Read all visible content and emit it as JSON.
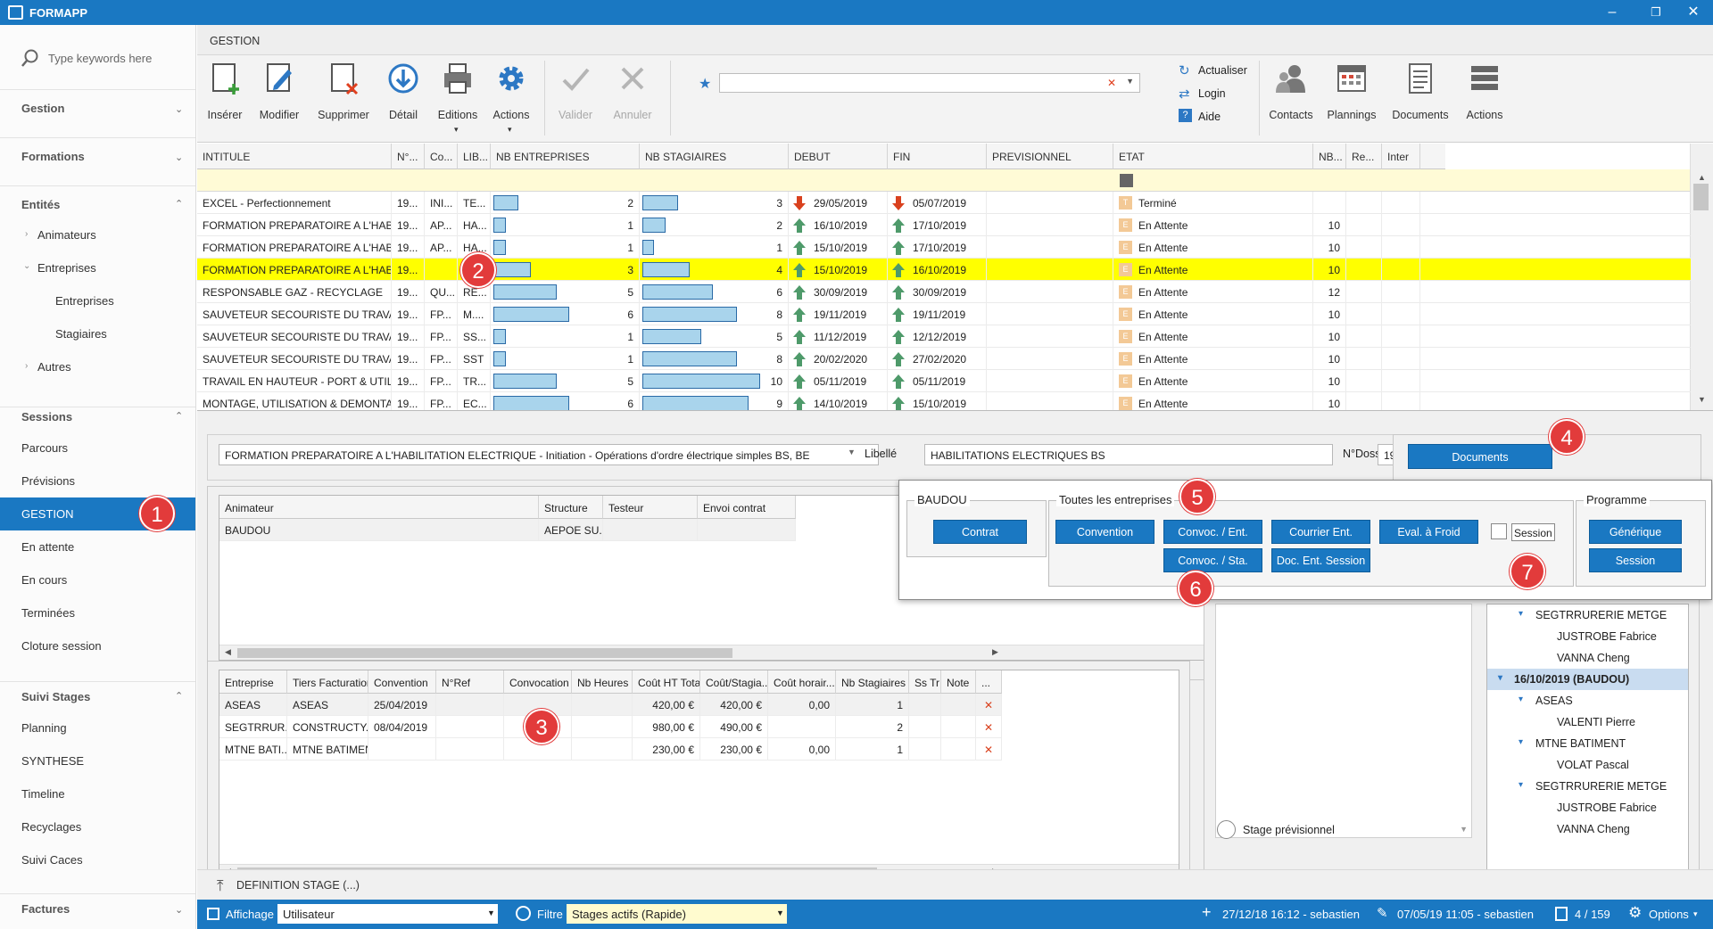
{
  "app": {
    "title": "FORMAPP"
  },
  "sidebar": {
    "search_placeholder": "Type keywords here",
    "sections": {
      "gestion": "Gestion",
      "formations": "Formations",
      "entites": "Entités",
      "sessions": "Sessions",
      "suivi": "Suivi Stages",
      "factures": "Factures"
    },
    "entites_items": [
      "Animateurs",
      "Entreprises",
      "Entreprises",
      "Stagiaires",
      "Autres"
    ],
    "sessions_items": [
      "Parcours",
      "Prévisions",
      "GESTION",
      "En attente",
      "En cours",
      "Terminées",
      "Cloture session"
    ],
    "suivi_items": [
      "Planning",
      "SYNTHESE",
      "Timeline",
      "Recyclages",
      "Suivi Caces"
    ]
  },
  "badges": [
    "1",
    "2",
    "3",
    "4",
    "5",
    "6",
    "7"
  ],
  "ribbon": {
    "tab": "GESTION",
    "buttons": [
      "Insérer",
      "Modifier",
      "Supprimer",
      "Détail",
      "Editions",
      "Actions",
      "Valider",
      "Annuler"
    ],
    "links": [
      "Actualiser",
      "Login",
      "Aide"
    ],
    "right_buttons": [
      "Contacts",
      "Plannings",
      "Documents",
      "Actions"
    ]
  },
  "grid": {
    "headers": [
      "INTITULE",
      "N°...",
      "Co...",
      "LIB...",
      "NB ENTREPRISES",
      "NB STAGIAIRES",
      "DEBUT",
      "FIN",
      "PREVISIONNEL",
      "ETAT",
      "NB...",
      "Re...",
      "Inter"
    ],
    "rows": [
      {
        "intitule": "EXCEL - Perfectionnement",
        "num": "19...",
        "co": "INI...",
        "lib": "TE...",
        "ent": 2,
        "stag": 3,
        "debut": "29/05/2019",
        "fin": "05/07/2019",
        "etat": "Terminé",
        "etat_code": "T",
        "nb": "",
        "dir": "down"
      },
      {
        "intitule": "FORMATION PREPARATOIRE A L'HABILITA...",
        "num": "19...",
        "co": "AP...",
        "lib": "HA...",
        "ent": 1,
        "stag": 2,
        "debut": "16/10/2019",
        "fin": "17/10/2019",
        "etat": "En Attente",
        "etat_code": "E",
        "nb": "10",
        "dir": "up"
      },
      {
        "intitule": "FORMATION PREPARATOIRE A L'HABILITA...",
        "num": "19...",
        "co": "AP...",
        "lib": "HA...",
        "ent": 1,
        "stag": 1,
        "debut": "15/10/2019",
        "fin": "17/10/2019",
        "etat": "En Attente",
        "etat_code": "E",
        "nb": "10",
        "dir": "up"
      },
      {
        "intitule": "FORMATION PREPARATOIRE A L'HABILITA...",
        "num": "19...",
        "co": "",
        "lib": "HA...",
        "ent": 3,
        "stag": 4,
        "debut": "15/10/2019",
        "fin": "16/10/2019",
        "etat": "En Attente",
        "etat_code": "E",
        "nb": "10",
        "dir": "up"
      },
      {
        "intitule": "RESPONSABLE GAZ - RECYCLAGE",
        "num": "19...",
        "co": "QU...",
        "lib": "RE...",
        "ent": 5,
        "stag": 6,
        "debut": "30/09/2019",
        "fin": "30/09/2019",
        "etat": "En Attente",
        "etat_code": "E",
        "nb": "12",
        "dir": "up"
      },
      {
        "intitule": "SAUVETEUR SECOURISTE DU TRAVAIL -...",
        "num": "19...",
        "co": "FP...",
        "lib": "M....",
        "ent": 6,
        "stag": 8,
        "debut": "19/11/2019",
        "fin": "19/11/2019",
        "etat": "En Attente",
        "etat_code": "E",
        "nb": "10",
        "dir": "up"
      },
      {
        "intitule": "SAUVETEUR SECOURISTE DU TRAVAIL",
        "num": "19...",
        "co": "FP...",
        "lib": "SS...",
        "ent": 1,
        "stag": 5,
        "debut": "11/12/2019",
        "fin": "12/12/2019",
        "etat": "En Attente",
        "etat_code": "E",
        "nb": "10",
        "dir": "up"
      },
      {
        "intitule": "SAUVETEUR SECOURISTE DU TRAVAIL",
        "num": "19...",
        "co": "FP...",
        "lib": "SST",
        "ent": 1,
        "stag": 8,
        "debut": "20/02/2020",
        "fin": "27/02/2020",
        "etat": "En Attente",
        "etat_code": "E",
        "nb": "10",
        "dir": "up"
      },
      {
        "intitule": "TRAVAIL EN HAUTEUR - PORT & UTILISA...",
        "num": "19...",
        "co": "FP...",
        "lib": "TR...",
        "ent": 5,
        "stag": 10,
        "debut": "05/11/2019",
        "fin": "05/11/2019",
        "etat": "En Attente",
        "etat_code": "E",
        "nb": "10",
        "dir": "up"
      },
      {
        "intitule": "MONTAGE, UTILISATION & DEMONTAGE...",
        "num": "19...",
        "co": "FP...",
        "lib": "EC...",
        "ent": 6,
        "stag": 9,
        "debut": "14/10/2019",
        "fin": "15/10/2019",
        "etat": "En Attente",
        "etat_code": "E",
        "nb": "10",
        "dir": "up"
      }
    ],
    "selected_index": 3
  },
  "detail": {
    "intitule": "FORMATION PREPARATOIRE A L'HABILITATION ELECTRIQUE - Initiation - Opérations d'ordre électrique simples BS, BE",
    "libelle_label": "Libellé",
    "libelle": "HABILITATIONS ELECTRIQUES BS",
    "dossier_label": "N°Dossier",
    "dossier": "19513",
    "documents_btn": "Documents"
  },
  "animateurs": {
    "headers": [
      "Animateur",
      "Structure",
      "Testeur",
      "Envoi contrat"
    ],
    "rows": [
      [
        "BAUDOU",
        "AEPOE SU...",
        "",
        ""
      ]
    ]
  },
  "entreprises": {
    "headers": [
      "Entreprise",
      "Tiers Facturation",
      "Convention",
      "N°Ref",
      "Convocation",
      "Nb Heures",
      "Coût HT Total",
      "Coût/Stagia...",
      "Coût horair...",
      "Nb Stagiaires",
      "Ss Tr",
      "Note",
      "..."
    ],
    "rows": [
      [
        "ASEAS",
        "ASEAS",
        "25/04/2019",
        "",
        "",
        "",
        "420,00 €",
        "420,00 €",
        "0,00",
        "1",
        "",
        ""
      ],
      [
        "SEGTRRUR...",
        "CONSTRUCTY...",
        "08/04/2019",
        "",
        "",
        "",
        "980,00 €",
        "490,00 €",
        "",
        "2",
        "",
        ""
      ],
      [
        "MTNE BATI...",
        "MTNE BATIMENT",
        "",
        "",
        "",
        "",
        "230,00 €",
        "230,00 €",
        "0,00",
        "1",
        "",
        ""
      ]
    ]
  },
  "popup": {
    "grp1": {
      "title": "BAUDOU",
      "btn": "Contrat"
    },
    "grp2": {
      "title": "Toutes les entreprises",
      "btns": [
        "Convention",
        "Convoc. / Ent.",
        "Courrier Ent.",
        "Eval. à Froid",
        "Convoc. / Sta.",
        "Doc. Ent. Session"
      ],
      "check_label": "Session"
    },
    "grp3": {
      "title": "Programme",
      "btns": [
        "Générique",
        "Session"
      ]
    }
  },
  "tree": [
    {
      "text": "SEGTRRURERIE METGE",
      "level": 1,
      "exp": true
    },
    {
      "text": "JUSTROBE Fabrice",
      "level": 2
    },
    {
      "text": "VANNA Cheng",
      "level": 2
    },
    {
      "text": "16/10/2019 (BAUDOU)",
      "level": 0,
      "exp": true,
      "sel": true
    },
    {
      "text": "ASEAS",
      "level": 1,
      "exp": true
    },
    {
      "text": "VALENTI Pierre",
      "level": 2
    },
    {
      "text": "MTNE BATIMENT",
      "level": 1,
      "exp": true
    },
    {
      "text": "VOLAT Pascal",
      "level": 2
    },
    {
      "text": "SEGTRRURERIE METGE",
      "level": 1,
      "exp": true
    },
    {
      "text": "JUSTROBE Fabrice",
      "level": 2
    },
    {
      "text": "VANNA Cheng",
      "level": 2
    }
  ],
  "stage_prev": "Stage prévisionnel",
  "def_stage": "DEFINITION STAGE (...)",
  "status": {
    "affichage_label": "Affichage",
    "affichage_value": "Utilisateur",
    "filtre_label": "Filtre",
    "filtre_value": "Stages actifs (Rapide)",
    "created": "27/12/18 16:12 - sebastien",
    "modified": "07/05/19 11:05 - sebastien",
    "count": "4 / 159",
    "options": "Options"
  },
  "colors": {
    "accent": "#1a78c2",
    "selected_row": "#ffff00",
    "badge": "#e23b3b"
  }
}
